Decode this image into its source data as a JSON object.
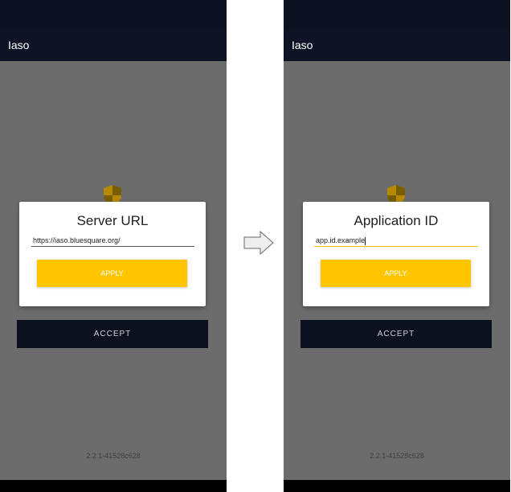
{
  "left_screen": {
    "app_title": "Iaso",
    "dialog": {
      "title": "Server URL",
      "input_value": "https://iaso.bluesquare.org/",
      "apply_label": "APPLY"
    },
    "accept_label": "ACCEPT",
    "version": "2.2.1-41528c628"
  },
  "right_screen": {
    "app_title": "Iaso",
    "dialog": {
      "title": "Application ID",
      "input_value": "app.id.example",
      "apply_label": "APPLY"
    },
    "accept_label": "ACCEPT",
    "version": "2.2.1-41528c628"
  },
  "transition_icon": "right-arrow-icon",
  "colors": {
    "app_bar": "#0e1426",
    "accent": "#ffc500",
    "overlay": "#6c6c6c",
    "accept_button": "#0c1120"
  }
}
